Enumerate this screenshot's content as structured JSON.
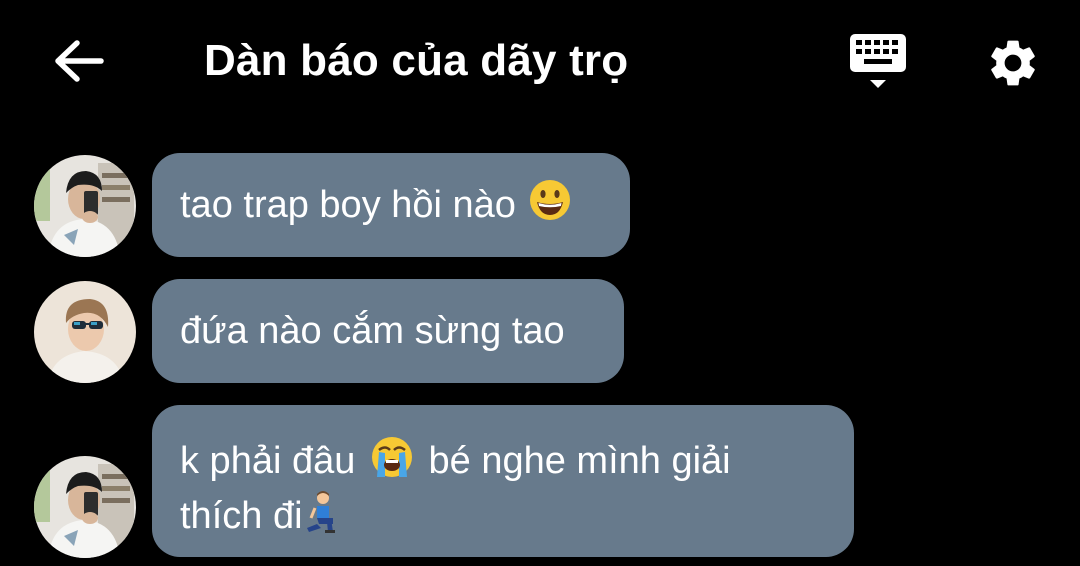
{
  "header": {
    "title": "Dàn báo của dãy trọ",
    "back_icon": "arrow-left-icon",
    "keyboard_icon": "keyboard-icon",
    "settings_icon": "gear-icon"
  },
  "colors": {
    "background": "#000000",
    "bubble": "#677a8c",
    "text": "#ffffff"
  },
  "messages": [
    {
      "text": "tao trap boy hồi nào",
      "emoji": "grinning-face-emoji",
      "avatar": "user-a-avatar"
    },
    {
      "text": "đứa nào cắm sừng tao",
      "avatar": "user-b-avatar"
    },
    {
      "line1_a": "k phải đâu",
      "emoji1": "loudly-crying-face-emoji",
      "line1_b": "bé nghe mình giải",
      "line2": "thích đi",
      "emoji2": "man-kneeling-emoji",
      "avatar": "user-a-avatar"
    }
  ]
}
